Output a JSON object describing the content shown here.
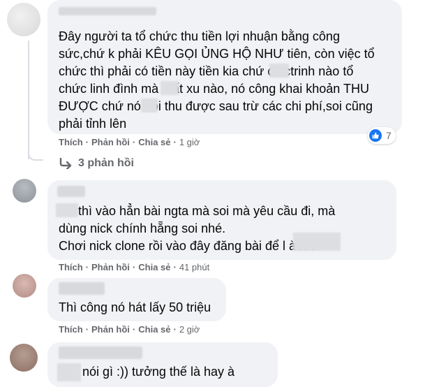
{
  "comments": [
    {
      "lines": [
        "Đây người ta tổ chức thu tiền lợi nhuận bằng công",
        "sức,chứ k phải KÊU GỌI ỦNG HỘ NHƯ tiên, còn việc tổ",
        "chức thì phải có tiền này tiền kia chứ      có ctrinh nào tổ",
        "chức linh đình mà      mất xu nào, nó công khai khoản THU",
        "ĐƯỢC chứ nó      nói thu được sau trừ các chi phí,soi cũng",
        "phải tỉnh lên"
      ],
      "reaction_count": "7",
      "like_label": "Thích",
      "reply_label": "Phản hồi",
      "share_label": "Chia sẻ",
      "time": "1 giờ"
    },
    {
      "lines": [
        "        soi thì vào hẳn bài ngta mà soi mà yêu cầu đi, mà",
        "dùng nick chính hẵng soi nhé.",
        "Chơi nick clone rồi vào đây đăng bài để l              à???"
      ],
      "like_label": "Thích",
      "reply_label": "Phản hồi",
      "share_label": "Chia sẻ",
      "time": "41 phút"
    },
    {
      "lines": [
        "Thì công nó hát lấy 50 triệu"
      ],
      "like_label": "Thích",
      "reply_label": "Phản hồi",
      "share_label": "Chia sẻ",
      "time": "2 giờ"
    },
    {
      "lines": [
        "         biết nói gì :)) tưởng thế là hay à"
      ]
    }
  ],
  "replies_label": "3 phản hồi",
  "colors": {
    "like_blue": "#1877f2",
    "bubble": "#f0f2f5",
    "meta": "#65676b"
  }
}
